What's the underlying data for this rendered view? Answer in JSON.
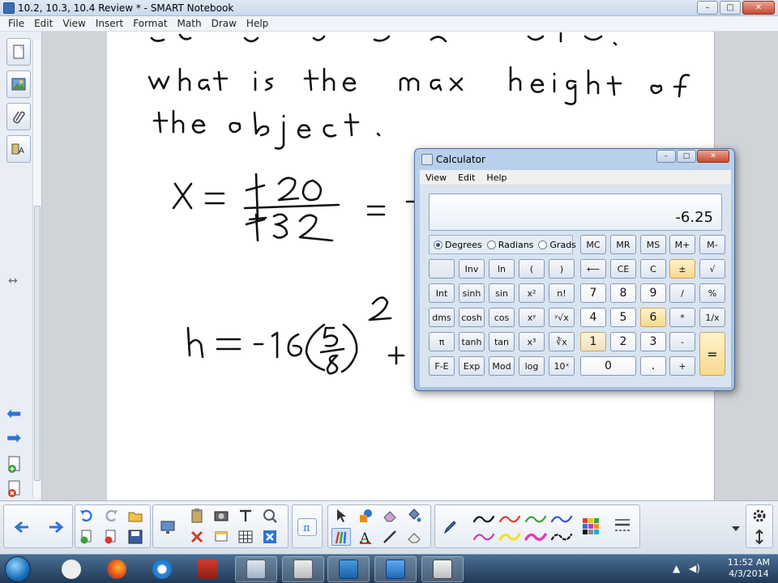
{
  "window": {
    "title": "10.2, 10.3, 10.4 Review * - SMART Notebook",
    "minimize": "–",
    "maximize": "□",
    "close": "✕"
  },
  "menu": [
    "File",
    "Edit",
    "View",
    "Insert",
    "Format",
    "Math",
    "Draw",
    "Help"
  ],
  "calculator": {
    "title": "Calculator",
    "menu": [
      "View",
      "Edit",
      "Help"
    ],
    "display": "-6.25",
    "angle_modes": [
      "Degrees",
      "Radians",
      "Grads"
    ],
    "angle_selected": "Degrees",
    "memory_keys": [
      "MC",
      "MR",
      "MS",
      "M+",
      "M-"
    ],
    "rows": [
      [
        "",
        "Inv",
        "ln",
        "(",
        ")",
        "⟵",
        "CE",
        "C",
        "±",
        "√"
      ],
      [
        "Int",
        "sinh",
        "sin",
        "x²",
        "n!",
        "7",
        "8",
        "9",
        "/",
        "%"
      ],
      [
        "dms",
        "cosh",
        "cos",
        "xʸ",
        "ʸ√x",
        "4",
        "5",
        "6",
        "*",
        "1/x"
      ],
      [
        "π",
        "tanh",
        "tan",
        "x³",
        "∛x",
        "1",
        "2",
        "3",
        "-",
        "="
      ],
      [
        "F-E",
        "Exp",
        "Mod",
        "log",
        "10ˣ",
        "0",
        ".",
        "+"
      ]
    ]
  },
  "taskbar": {
    "time": "11:52 AM",
    "date": "4/3/2014"
  },
  "colors": {
    "accent": "#2b74d6",
    "calc_highlight": "#f7d98f"
  }
}
